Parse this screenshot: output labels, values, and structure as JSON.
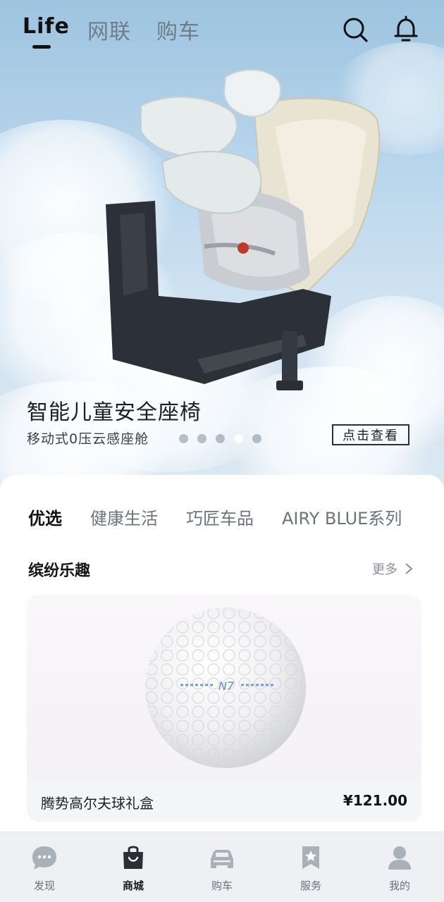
{
  "header": {
    "tabs": [
      {
        "label": "Life",
        "active": true
      },
      {
        "label": "网联",
        "active": false
      },
      {
        "label": "购车",
        "active": false
      }
    ],
    "icons": [
      "search-icon",
      "bell-icon"
    ]
  },
  "banner": {
    "title": "智能儿童安全座椅",
    "subtitle": "移动式0压云感座舱",
    "cta_label": "点击查看",
    "slide_count": 5,
    "active_slide": 4
  },
  "categories": {
    "tabs": [
      "优选",
      "健康生活",
      "巧匠车品",
      "AIRY BLUE系列"
    ],
    "active_index": 0
  },
  "section": {
    "title": "缤纷乐趣",
    "more_label": "更多"
  },
  "product": {
    "name": "腾势高尔夫球礼盒",
    "price": "¥121.00",
    "logo_text": "N7"
  },
  "bottom_nav": {
    "items": [
      {
        "label": "发现",
        "icon": "chat-bubble-icon",
        "active": false
      },
      {
        "label": "商城",
        "icon": "shopping-bag-icon",
        "active": true
      },
      {
        "label": "购车",
        "icon": "car-icon",
        "active": false
      },
      {
        "label": "服务",
        "icon": "bookmark-star-icon",
        "active": false
      },
      {
        "label": "我的",
        "icon": "person-icon",
        "active": false
      }
    ]
  },
  "colors": {
    "accent": "#111111",
    "muted_text": "#6c737a",
    "sky": "#b9d6ec"
  }
}
